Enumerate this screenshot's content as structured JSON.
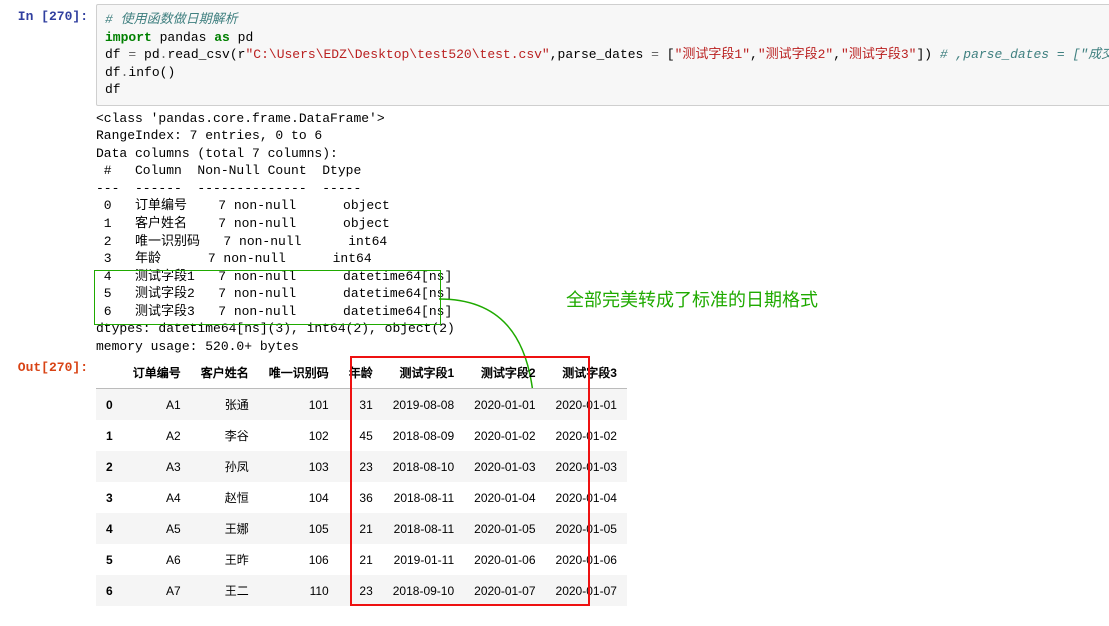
{
  "in_prompt": "In [270]:",
  "out_prompt": "Out[270]:",
  "code": {
    "comment1": "# 使用函数做日期解析",
    "kw_import": "import",
    "mod": "pandas",
    "kw_as": "as",
    "alias": "pd",
    "line3_a": "df ",
    "eq": "=",
    "line3_b": " pd",
    "dot": ".",
    "read": "read_csv",
    "p_open": "(",
    "raw_r": "r",
    "str_path": "\"C:\\Users\\EDZ\\Desktop\\test520\\test.csv\"",
    "comma": ",",
    "arg_pd": "parse_dates ",
    "arg_eq": "=",
    "list_open": " [",
    "s1": "\"测试字段1\"",
    "s2": "\"测试字段2\"",
    "s3": "\"测试字段3\"",
    "list_close": "]",
    "p_close": ")",
    "trail_comment": " # ,parse_dates = [\"成交时间\"]",
    "line4": "df",
    "info": "info",
    "empty_p": "()",
    "line5": "df"
  },
  "stdout_lines": [
    "<class 'pandas.core.frame.DataFrame'>",
    "RangeIndex: 7 entries, 0 to 6",
    "Data columns (total 7 columns):",
    " #   Column  Non-Null Count  Dtype         ",
    "---  ------  --------------  -----         ",
    " 0   订单编号    7 non-null      object        ",
    " 1   客户姓名    7 non-null      object        ",
    " 2   唯一识别码   7 non-null      int64         ",
    " 3   年龄      7 non-null      int64         ",
    " 4   测试字段1   7 non-null      datetime64[ns]",
    " 5   测试字段2   7 non-null      datetime64[ns]",
    " 6   测试字段3   7 non-null      datetime64[ns]",
    "dtypes: datetime64[ns](3), int64(2), object(2)",
    "memory usage: 520.0+ bytes"
  ],
  "annotation": "全部完美转成了标准的日期格式",
  "table": {
    "columns": [
      "订单编号",
      "客户姓名",
      "唯一识别码",
      "年龄",
      "测试字段1",
      "测试字段2",
      "测试字段3"
    ],
    "index": [
      "0",
      "1",
      "2",
      "3",
      "4",
      "5",
      "6"
    ],
    "rows": [
      [
        "A1",
        "张通",
        "101",
        "31",
        "2019-08-08",
        "2020-01-01",
        "2020-01-01"
      ],
      [
        "A2",
        "李谷",
        "102",
        "45",
        "2018-08-09",
        "2020-01-02",
        "2020-01-02"
      ],
      [
        "A3",
        "孙凤",
        "103",
        "23",
        "2018-08-10",
        "2020-01-03",
        "2020-01-03"
      ],
      [
        "A4",
        "赵恒",
        "104",
        "36",
        "2018-08-11",
        "2020-01-04",
        "2020-01-04"
      ],
      [
        "A5",
        "王娜",
        "105",
        "21",
        "2018-08-11",
        "2020-01-05",
        "2020-01-05"
      ],
      [
        "A6",
        "王昨",
        "106",
        "21",
        "2019-01-11",
        "2020-01-06",
        "2020-01-06"
      ],
      [
        "A7",
        "王二",
        "110",
        "23",
        "2018-09-10",
        "2020-01-07",
        "2020-01-07"
      ]
    ]
  }
}
